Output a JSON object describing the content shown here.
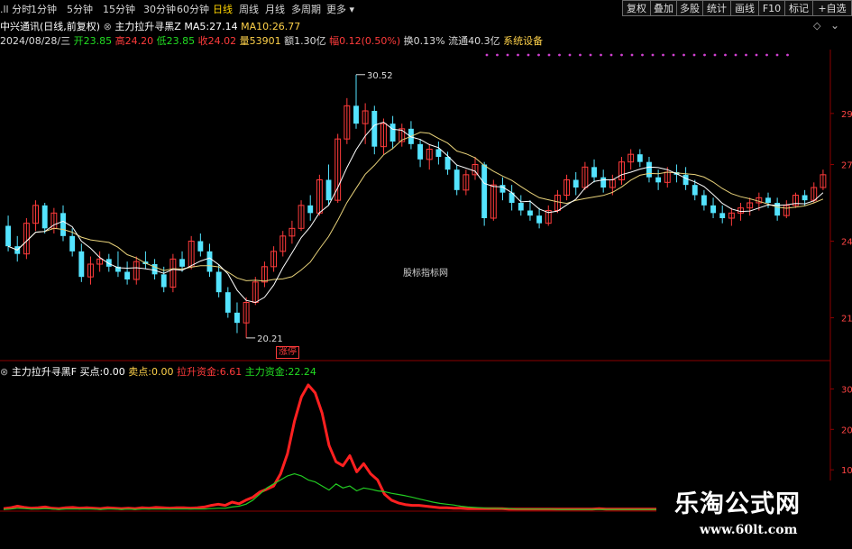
{
  "toolbar": {
    "periods": [
      "分时",
      "1分钟",
      "5分钟",
      "15分钟",
      "30分钟",
      "60分钟",
      "日线",
      "周线",
      "月线",
      "多周期",
      "更多"
    ],
    "active_period": "日线",
    "right_buttons": [
      "复权",
      "叠加",
      "多股",
      "统计",
      "画线",
      "F10",
      "标记",
      "+自选"
    ]
  },
  "main_chart": {
    "stock_title": "中兴通讯(日线,前复权)",
    "indicator_name": "主力拉升寻黑Z",
    "ma5_label": "MA5:",
    "ma5_value": "27.14",
    "ma10_label": "MA10:",
    "ma10_value": "26.77",
    "date": "2024/08/28/三",
    "open_label": "开",
    "open_value": "23.85",
    "high_label": "高",
    "high_value": "24.20",
    "low_label": "低",
    "low_value": "23.85",
    "close_label": "收",
    "close_value": "24.02",
    "volume_label": "量",
    "volume_value": "53901",
    "amount_label": "额",
    "amount_value": "1.30亿",
    "change_label": "幅",
    "change_value": "0.12(0.50%)",
    "turnover_label": "换",
    "turnover_value": "0.13%",
    "float_label": "流通",
    "float_value": "40.3亿",
    "sector": "系统设备",
    "high_mark": "30.52",
    "low_mark": "20.21",
    "watermark": "股标指标网",
    "limit_tag": "涨停",
    "price_axis_ticks": [
      "29",
      "27",
      "24",
      "21"
    ]
  },
  "sub_chart": {
    "indicator_name": "主力拉升寻黑F",
    "buy_label": "买点:",
    "buy_value": "0.00",
    "sell_label": "卖点:",
    "sell_value": "0.00",
    "pull_label": "拉升资金:",
    "pull_value": "6.61",
    "main_label": "主力资金:",
    "main_value": "22.24",
    "axis_ticks": [
      "30",
      "20",
      "10"
    ]
  },
  "brand": {
    "name": "乐淘公式网",
    "url": "www.60lt.com"
  },
  "colors": {
    "up": "#ff3b3b",
    "down": "#54e4ff",
    "ma5": "#ffffff",
    "ma10": "#e8d27a",
    "pull_line": "#ff2020",
    "main_line": "#22cc22",
    "active_tab": "#ffd400",
    "axis": "#8b0000"
  },
  "chart_data": [
    {
      "type": "candlestick",
      "title": "中兴通讯(日线,前复权)",
      "annotations": {
        "high": 30.52,
        "low": 20.21
      },
      "ylim": [
        19.5,
        31.5
      ],
      "candles_ohlc": [
        [
          24.6,
          25.0,
          23.6,
          23.8
        ],
        [
          23.8,
          24.2,
          23.2,
          23.5
        ],
        [
          23.5,
          24.9,
          23.3,
          24.7
        ],
        [
          24.7,
          25.6,
          24.4,
          25.4
        ],
        [
          25.4,
          25.5,
          24.3,
          24.5
        ],
        [
          24.5,
          25.3,
          24.3,
          25.1
        ],
        [
          25.1,
          25.4,
          24.0,
          24.2
        ],
        [
          24.2,
          24.5,
          23.4,
          23.6
        ],
        [
          23.6,
          23.9,
          22.4,
          22.6
        ],
        [
          22.6,
          23.4,
          22.3,
          23.1
        ],
        [
          23.1,
          23.6,
          22.8,
          23.3
        ],
        [
          23.3,
          23.5,
          22.8,
          23.0
        ],
        [
          23.0,
          23.6,
          22.6,
          22.8
        ],
        [
          22.8,
          23.2,
          22.3,
          22.5
        ],
        [
          22.5,
          23.4,
          22.3,
          23.2
        ],
        [
          23.2,
          23.6,
          22.9,
          23.1
        ],
        [
          23.1,
          23.3,
          22.5,
          22.7
        ],
        [
          22.7,
          23.0,
          22.0,
          22.2
        ],
        [
          22.2,
          23.5,
          22.0,
          23.3
        ],
        [
          23.3,
          23.6,
          22.8,
          23.0
        ],
        [
          23.0,
          24.2,
          22.9,
          24.0
        ],
        [
          24.0,
          24.3,
          23.4,
          23.6
        ],
        [
          23.6,
          23.9,
          22.6,
          22.8
        ],
        [
          22.8,
          23.1,
          21.8,
          22.0
        ],
        [
          22.0,
          22.2,
          21.0,
          21.2
        ],
        [
          21.2,
          21.6,
          20.4,
          20.8
        ],
        [
          20.8,
          21.8,
          20.21,
          21.6
        ],
        [
          21.6,
          22.6,
          21.5,
          22.4
        ],
        [
          22.4,
          23.2,
          22.2,
          23.0
        ],
        [
          23.0,
          23.8,
          22.8,
          23.6
        ],
        [
          23.6,
          24.4,
          23.4,
          24.2
        ],
        [
          24.2,
          24.8,
          23.9,
          24.5
        ],
        [
          24.5,
          25.6,
          24.4,
          25.4
        ],
        [
          25.4,
          25.8,
          24.8,
          25.1
        ],
        [
          25.1,
          26.6,
          25.0,
          26.4
        ],
        [
          26.4,
          27.0,
          25.4,
          25.6
        ],
        [
          25.6,
          28.2,
          25.5,
          28.0
        ],
        [
          28.0,
          29.6,
          27.8,
          29.3
        ],
        [
          29.3,
          30.52,
          28.4,
          28.6
        ],
        [
          28.6,
          29.4,
          27.8,
          29.1
        ],
        [
          29.1,
          29.3,
          27.4,
          27.7
        ],
        [
          27.7,
          28.8,
          27.4,
          28.6
        ],
        [
          28.6,
          28.9,
          27.6,
          27.9
        ],
        [
          27.9,
          28.6,
          27.7,
          28.4
        ],
        [
          28.4,
          28.7,
          27.6,
          27.8
        ],
        [
          27.8,
          28.0,
          26.9,
          27.2
        ],
        [
          27.2,
          27.8,
          26.8,
          27.6
        ],
        [
          27.6,
          27.9,
          27.0,
          27.3
        ],
        [
          27.3,
          27.5,
          26.6,
          26.8
        ],
        [
          26.8,
          27.0,
          25.8,
          26.0
        ],
        [
          26.0,
          26.8,
          25.8,
          26.6
        ],
        [
          26.6,
          27.3,
          26.4,
          27.0
        ],
        [
          27.0,
          27.1,
          24.6,
          24.9
        ],
        [
          24.9,
          26.4,
          24.8,
          26.2
        ],
        [
          26.2,
          26.5,
          25.6,
          25.9
        ],
        [
          25.9,
          26.2,
          25.2,
          25.5
        ],
        [
          25.5,
          25.8,
          25.0,
          25.2
        ],
        [
          25.2,
          25.6,
          24.8,
          25.0
        ],
        [
          25.0,
          25.3,
          24.5,
          24.7
        ],
        [
          24.7,
          25.4,
          24.6,
          25.2
        ],
        [
          25.2,
          26.0,
          25.1,
          25.8
        ],
        [
          25.8,
          26.6,
          25.6,
          26.4
        ],
        [
          26.4,
          26.7,
          25.8,
          26.1
        ],
        [
          26.1,
          27.1,
          26.0,
          26.9
        ],
        [
          26.9,
          27.2,
          26.3,
          26.5
        ],
        [
          26.5,
          26.8,
          25.9,
          26.1
        ],
        [
          26.1,
          26.6,
          25.8,
          26.4
        ],
        [
          26.4,
          27.3,
          26.2,
          27.1
        ],
        [
          27.1,
          27.6,
          26.8,
          27.4
        ],
        [
          27.4,
          27.6,
          26.9,
          27.1
        ],
        [
          27.1,
          27.3,
          26.3,
          26.5
        ],
        [
          26.5,
          26.8,
          26.0,
          26.3
        ],
        [
          26.3,
          26.9,
          26.1,
          26.7
        ],
        [
          26.7,
          27.0,
          26.3,
          26.6
        ],
        [
          26.6,
          26.9,
          26.0,
          26.2
        ],
        [
          26.2,
          26.4,
          25.6,
          25.8
        ],
        [
          25.8,
          26.0,
          25.2,
          25.4
        ],
        [
          25.4,
          25.7,
          24.9,
          25.1
        ],
        [
          25.1,
          25.4,
          24.7,
          24.9
        ],
        [
          24.9,
          25.3,
          24.6,
          25.1
        ],
        [
          25.1,
          25.5,
          24.8,
          25.3
        ],
        [
          25.3,
          25.7,
          25.0,
          25.5
        ],
        [
          25.5,
          25.9,
          25.2,
          25.7
        ],
        [
          25.7,
          25.9,
          25.3,
          25.5
        ],
        [
          25.5,
          25.7,
          24.8,
          25.0
        ],
        [
          25.0,
          25.6,
          24.9,
          25.4
        ],
        [
          25.4,
          25.9,
          25.3,
          25.8
        ],
        [
          25.8,
          26.0,
          25.4,
          25.6
        ],
        [
          25.6,
          26.3,
          25.5,
          26.1
        ],
        [
          26.1,
          26.8,
          26.0,
          26.6
        ]
      ]
    },
    {
      "type": "line",
      "title": "主力拉升寻黑F",
      "series": [
        {
          "name": "拉升资金",
          "values": [
            0.4,
            0.6,
            1.0,
            0.7,
            0.5,
            0.6,
            0.8,
            0.5,
            0.4,
            0.6,
            0.7,
            0.5,
            0.6,
            0.5,
            0.4,
            0.6,
            0.5,
            0.4,
            0.5,
            0.4,
            0.6,
            0.5,
            0.7,
            0.6,
            0.5,
            0.6,
            0.6,
            0.5,
            0.6,
            0.8,
            1.2,
            1.5,
            1.2,
            2.0,
            1.6,
            2.5,
            3.2,
            4.5,
            5.2,
            6.0,
            9.0,
            14.0,
            22.0,
            28.0,
            31.0,
            29.0,
            24.0,
            16.0,
            12.0,
            11.0,
            13.5,
            9.5,
            11.5,
            9.0,
            7.5,
            4.0,
            2.5,
            1.8,
            1.4,
            1.2,
            1.2,
            1.0,
            0.8,
            0.6,
            0.6,
            0.5,
            0.5,
            0.4,
            0.4,
            0.4,
            0.4,
            0.4,
            0.4,
            0.3,
            0.3,
            0.3,
            0.3,
            0.3,
            0.3,
            0.3,
            0.3,
            0.3,
            0.3,
            0.3,
            0.3,
            0.3,
            0.4,
            0.3,
            0.3,
            0.3,
            0.3,
            0.3,
            0.3,
            0.3,
            0.3,
            0.3,
            0.3,
            0.3,
            0.3,
            0.3,
            0.3,
            0.3,
            0.3,
            0.3,
            0.3,
            0.4,
            0.3,
            0.3,
            0.4,
            0.4,
            0.4,
            0.4,
            0.4,
            0.3,
            0.3,
            0.3,
            0.3,
            0.4,
            0.3,
            0.3
          ]
        },
        {
          "name": "主力资金",
          "values": [
            0.2,
            0.3,
            0.5,
            0.4,
            0.3,
            0.3,
            0.4,
            0.3,
            0.2,
            0.3,
            0.3,
            0.3,
            0.3,
            0.3,
            0.2,
            0.3,
            0.3,
            0.2,
            0.3,
            0.2,
            0.3,
            0.3,
            0.3,
            0.3,
            0.3,
            0.3,
            0.3,
            0.3,
            0.3,
            0.3,
            0.4,
            0.5,
            0.5,
            0.8,
            1.0,
            1.5,
            2.5,
            4.0,
            5.5,
            6.5,
            7.5,
            8.5,
            9.0,
            8.5,
            7.5,
            7.0,
            6.0,
            5.0,
            6.5,
            5.5,
            6.0,
            4.8,
            5.5,
            5.2,
            4.8,
            4.6,
            4.2,
            3.9,
            3.6,
            3.2,
            2.8,
            2.4,
            2.0,
            1.7,
            1.5,
            1.3,
            1.0,
            0.8,
            0.7,
            0.6,
            0.5,
            0.5,
            0.4,
            0.4,
            0.3,
            0.3,
            0.3,
            0.3,
            0.3,
            0.3,
            0.2,
            0.2,
            0.2,
            0.2,
            0.2,
            0.2,
            0.2,
            0.2,
            0.2,
            0.2,
            0.2,
            0.2,
            0.2,
            0.2,
            0.2,
            0.2,
            0.2,
            0.2,
            0.2,
            0.2,
            0.2,
            0.2,
            0.2,
            0.2,
            0.2,
            0.2,
            0.2,
            0.2,
            0.2,
            0.2,
            0.2,
            0.2,
            0.2,
            0.2,
            0.2,
            0.2,
            0.2,
            0.2,
            0.2,
            0.2
          ]
        }
      ],
      "ylim": [
        0,
        33
      ]
    }
  ]
}
